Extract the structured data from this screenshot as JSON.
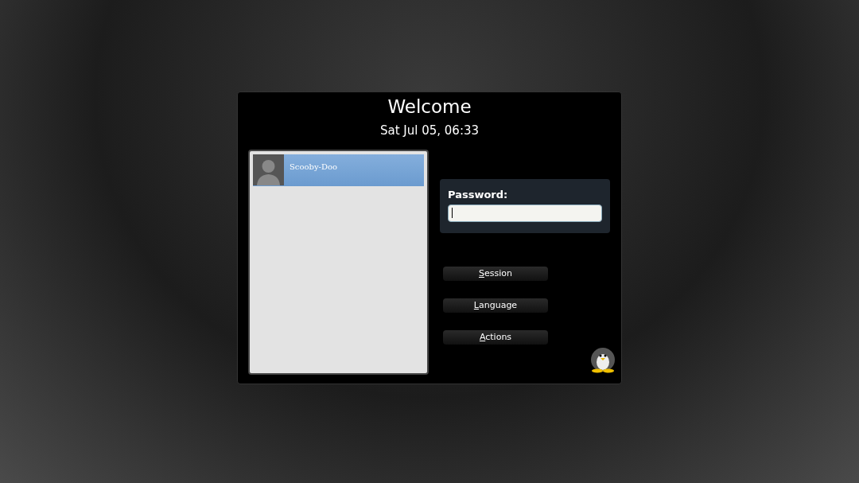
{
  "title": "Welcome",
  "datetime": "Sat Jul 05, 06:33",
  "users": [
    {
      "name": "Scooby-Doo",
      "selected": true
    }
  ],
  "password": {
    "label": "Password:",
    "focused": true
  },
  "buttons": [
    "Session",
    "Language",
    "Actions"
  ]
}
